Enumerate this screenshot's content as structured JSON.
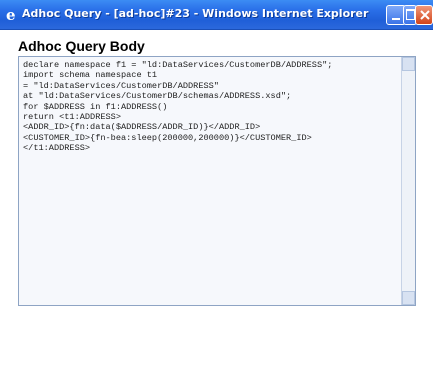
{
  "window": {
    "title": "Adhoc Query - [ad-hoc]#23 - Windows Internet Explorer"
  },
  "page": {
    "heading": "Adhoc Query Body"
  },
  "query": {
    "text": "declare namespace f1 = \"ld:DataServices/CustomerDB/ADDRESS\";\nimport schema namespace t1\n= \"ld:DataServices/CustomerDB/ADDRESS\"\nat \"ld:DataServices/CustomerDB/schemas/ADDRESS.xsd\";\nfor $ADDRESS in f1:ADDRESS()\nreturn <t1:ADDRESS>\n<ADDR_ID>{fn:data($ADDRESS/ADDR_ID)}</ADDR_ID>\n<CUSTOMER_ID>{fn-bea:sleep(200000,200000)}</CUSTOMER_ID>\n</t1:ADDRESS>"
  },
  "icons": {
    "app": "ie-icon",
    "minimize": "minimize-icon",
    "maximize": "maximize-icon",
    "close": "close-icon"
  },
  "colors": {
    "titlebar": "#2a6fe8",
    "close_button": "#d2441a",
    "code_background": "#f6f8fc"
  }
}
